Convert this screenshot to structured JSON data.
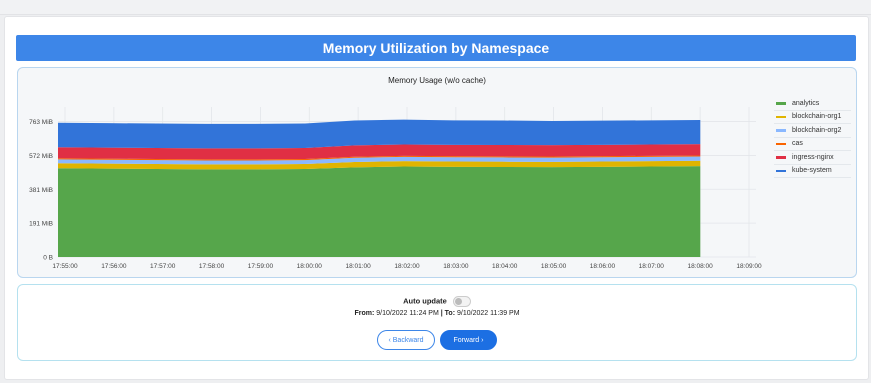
{
  "banner": {
    "title": "Memory Utilization by Namespace"
  },
  "chart": {
    "title": "Memory Usage (w/o cache)"
  },
  "chart_data": {
    "type": "area",
    "title": "Memory Usage (w/o cache)",
    "stacked": true,
    "x": [
      "17:55:00",
      "17:56:00",
      "17:57:00",
      "17:58:00",
      "17:59:00",
      "18:00:00",
      "18:01:00",
      "18:02:00",
      "18:03:00",
      "18:04:00",
      "18:05:00",
      "18:06:00",
      "18:07:00",
      "18:08:00"
    ],
    "x_ticks": [
      "17:55:00",
      "17:56:00",
      "17:57:00",
      "17:58:00",
      "17:59:00",
      "18:00:00",
      "18:01:00",
      "18:02:00",
      "18:03:00",
      "18:04:00",
      "18:05:00",
      "18:06:00",
      "18:07:00",
      "18:08:00",
      "18:09:00"
    ],
    "y_ticks": [
      "0 B",
      "191 MiB",
      "381 MiB",
      "572 MiB",
      "763 MiB"
    ],
    "ylim": [
      0,
      800
    ],
    "y_unit": "MiB",
    "grid": true,
    "legend_position": "right",
    "series": [
      {
        "name": "analytics",
        "color": "#56a64b",
        "values": [
          500,
          498,
          496,
          494,
          494,
          496,
          505,
          510,
          508,
          507,
          506,
          508,
          510,
          512
        ]
      },
      {
        "name": "blockchain-org1",
        "color": "#e0b400",
        "values": [
          28,
          28,
          28,
          28,
          28,
          28,
          30,
          30,
          30,
          30,
          30,
          30,
          30,
          30
        ]
      },
      {
        "name": "blockchain-org2",
        "color": "#8ab8ff",
        "values": [
          22,
          22,
          22,
          22,
          22,
          22,
          24,
          24,
          24,
          24,
          24,
          24,
          24,
          24
        ]
      },
      {
        "name": "cas",
        "color": "#fa6400",
        "values": [
          6,
          6,
          6,
          6,
          6,
          6,
          6,
          6,
          6,
          6,
          6,
          6,
          6,
          6
        ]
      },
      {
        "name": "ingress-nginx",
        "color": "#e02f44",
        "values": [
          62,
          62,
          62,
          62,
          62,
          62,
          64,
          64,
          64,
          64,
          64,
          64,
          64,
          64
        ]
      },
      {
        "name": "kube-system",
        "color": "#3274d9",
        "values": [
          138,
          138,
          138,
          138,
          138,
          138,
          140,
          140,
          138,
          138,
          136,
          136,
          136,
          136
        ]
      }
    ]
  },
  "controls": {
    "auto_update_label": "Auto update",
    "auto_update_on": false,
    "from_label": "From:",
    "from_value": "9/10/2022 11:24 PM",
    "separator": "|",
    "to_label": "To:",
    "to_value": "9/10/2022 11:39 PM",
    "backward_label": "‹ Backward",
    "forward_label": "Forward ›"
  }
}
